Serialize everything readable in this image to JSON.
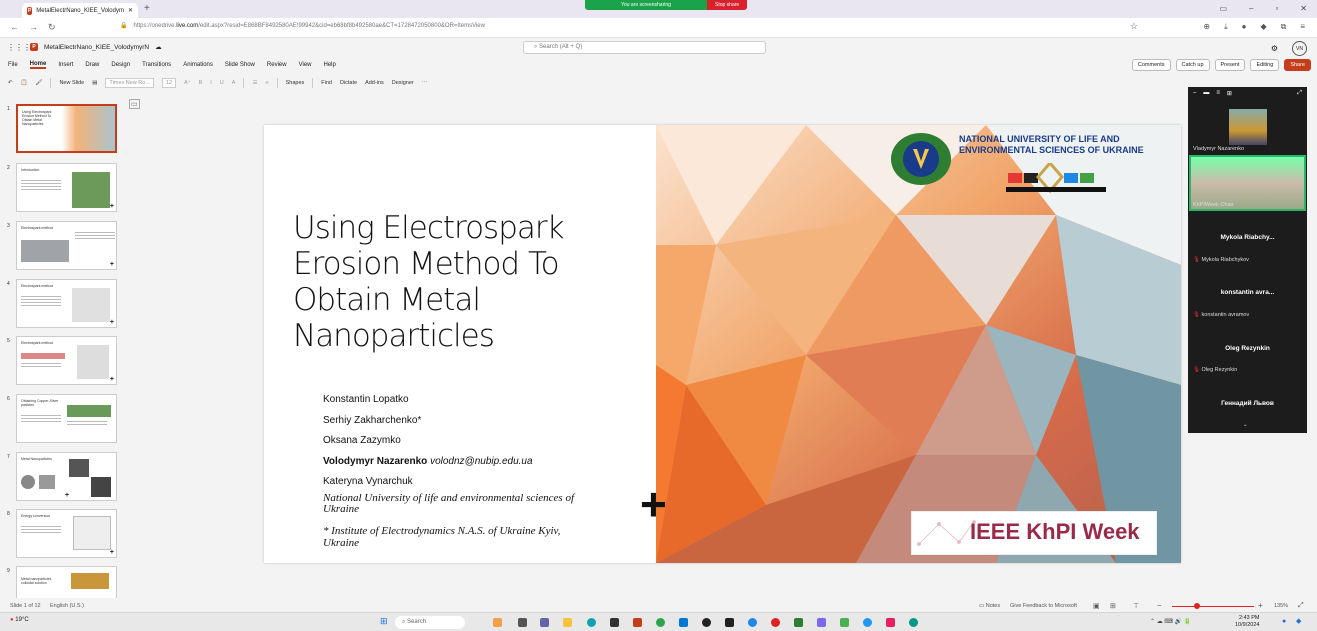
{
  "browser": {
    "tab_title": "MetalElectrNano_KIEE_Volodym",
    "new_tab": "+",
    "screen_share_text": "You are screensharing",
    "stop_share": "Stop share",
    "url_prefix": "https://onedrive.",
    "url_domain": "live.com",
    "url_rest": "/edit.aspx?resid=E868BF8492580AE!99942&cid=eb68bf8b492580ae&CT=1728472050800&OR=ItemsView"
  },
  "app": {
    "file_name": "MetalElectrNano_KIEE_VolodymyrN",
    "search_placeholder": "Search (Alt + Q)",
    "avatar_initials": "VN"
  },
  "ribbon": {
    "tabs": [
      "File",
      "Home",
      "Insert",
      "Draw",
      "Design",
      "Transitions",
      "Animations",
      "Slide Show",
      "Review",
      "View",
      "Help"
    ],
    "right_buttons": [
      "Comments",
      "Catch up",
      "Present",
      "Editing",
      "Share"
    ]
  },
  "toolbar": {
    "new_slide": "New Slide",
    "font_name": "Times New Ro...",
    "font_size": "12",
    "shapes": "Shapes",
    "find": "Find",
    "dictate": "Dictate",
    "add_ins": "Add-ins",
    "designer": "Designer"
  },
  "thumbnails": [
    {
      "num": "1",
      "title": "Using Electrospark Erosion Method To Obtain Metal Nanoparticles"
    },
    {
      "num": "2",
      "title": "Introduction"
    },
    {
      "num": "3",
      "title": "Electrospark method"
    },
    {
      "num": "4",
      "title": "Electrospark method"
    },
    {
      "num": "5",
      "title": "Electrospark method"
    },
    {
      "num": "6",
      "title": "Obtaining Copper-Silver particles"
    },
    {
      "num": "7",
      "title": "Metal Nanoparticles"
    },
    {
      "num": "8",
      "title": "Energy conversion"
    },
    {
      "num": "9",
      "title": "Metal nanoparticles colloidal solution"
    }
  ],
  "slide": {
    "title": "Using Electrospark Erosion Method To Obtain Metal Nanoparticles",
    "authors": [
      {
        "name": "Konstantin Lopatko",
        "extra": ""
      },
      {
        "name": "Serhiy Zakharchenko*",
        "extra": ""
      },
      {
        "name": "Oksana Zazymko",
        "extra": ""
      },
      {
        "name": "Volodymyr Nazarenko",
        "extra": "volodnz@nubip.edu.ua"
      },
      {
        "name": "Kateryna Vynarchuk",
        "extra": ""
      }
    ],
    "affiliation1": "National University of life and environmental sciences of Ukraine",
    "affiliation2": "* Institute of Electrodynamics N.A.S. of Ukraine Kyiv, Ukraine",
    "university": "NATIONAL UNIVERSITY OF LIFE AND ENVIRONMENTAL SCIENCES OF UKRAINE",
    "ieee_label": "IEEE KhPI Week",
    "plus": "+"
  },
  "video": {
    "participants": [
      {
        "tile_name": "Vladymyr Nazarenko"
      },
      {
        "tile_name": "KhPIWeek Chair"
      }
    ],
    "audio_only": [
      {
        "big": "Mykola  Riabchy...",
        "small": "Mykola Riabchykov"
      },
      {
        "big": "konstantin  avra...",
        "small": "konstantin avramov"
      },
      {
        "big": "Oleg Rezynkin",
        "small": "Oleg Rezynkin"
      },
      {
        "big": "Геннадий Львов",
        "small": ""
      }
    ]
  },
  "status": {
    "slide_counter": "Slide 1 of 12",
    "language": "English (U.S.)",
    "notes": "Notes",
    "feedback": "Give Feedback to Microsoft",
    "zoom": "135%"
  },
  "taskbar": {
    "weather": "19°C",
    "search": "Search",
    "time": "2:43 PM",
    "date": "10/9/2024"
  }
}
